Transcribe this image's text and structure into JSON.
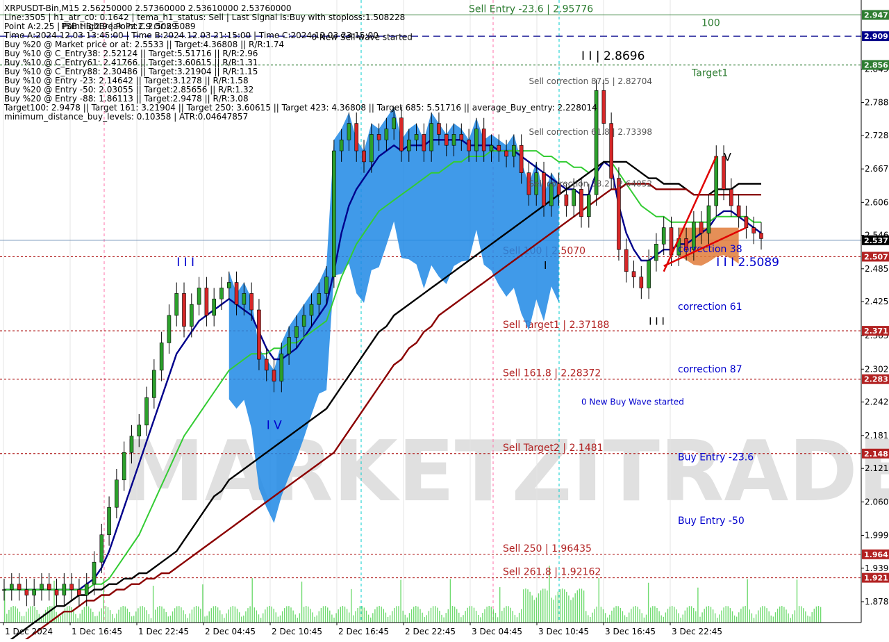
{
  "symbol_header": "XRPUSDT-Bin,M15  2.56250000 2.57360000 2.53610000 2.53760000",
  "info_lines": [
    "Line:3505 | h1_atr_c0: 0.1642 | tema_h1_status: Sell | Last Signal is:Buy with stoploss:1.508228",
    "Point A:2.25 | Point B:2.9 | Point C:2.5089",
    "Time A:2024.12.03 13:45:00 | Time B:2024.12.03 21:15:00 | Time C:2024.12.03 23:15:00",
    "Buy %20 @ Market price or at: 2.5533 || Target:4.36808 || R/R:1.74",
    "Buy %10 @ C_Entry38: 2.52124 || Target:5.51716 || R/R:2.96",
    "Buy %10 @ C_Entry61: 2.41766 || Target:3.60615 || R/R:1.31",
    "Buy %10 @ C_Entry88: 2.30486 || Target:3.21904 || R/R:1.15",
    "Buy %10 @ Entry -23: 2.14642 || Target:3.1278 || R/R:1.58",
    "Buy %20 @ Entry -50: 2.03055 || Target:2.85656 || R/R:1.32",
    "Buy %20 @ Entry -88: 1.86113 || Target:2.9478 || R/R:3.08",
    "Target100: 2.9478 || Target 161: 3.21904 || Target 250: 3.60615 || Target 423: 4.36808 || Target 685: 5.51716 || average_Buy_entry: 2.228014",
    "minimum_distance_buy_levels: 0.10358 | ATR:0.04647857"
  ],
  "overlay_header": "PSB HighBreak Pz:2.9 Or:2.5089",
  "watermark": "MARKETZITRADE",
  "colors": {
    "bull": "#2ca02c",
    "bear": "#d62728",
    "blue_cloud": "#1e88e5",
    "orange_cloud": "#e07b39",
    "green_line": "#33cc33",
    "navy_line": "#00008b",
    "black_line": "#000000",
    "maroon_line": "#8b0000",
    "volume": "#33cc33"
  },
  "chart_data": {
    "type": "line",
    "title": "XRPUSDT-Bin,M15",
    "ylim": [
      1.84,
      2.975
    ],
    "x_tick_labels": [
      "1 Dec 2024",
      "1 Dec 16:45",
      "1 Dec 22:45",
      "2 Dec 04:45",
      "2 Dec 10:45",
      "2 Dec 16:45",
      "2 Dec 22:45",
      "3 Dec 04:45",
      "3 Dec 10:45",
      "3 Dec 16:45",
      "3 Dec 22:45"
    ],
    "y_ticks": [
      1.878,
      1.939,
      1.999,
      2.06,
      2.121,
      2.181,
      2.242,
      2.302,
      2.363,
      2.425,
      2.485,
      2.546,
      2.606,
      2.667,
      2.728,
      2.788,
      2.849
    ],
    "current_price": 2.537,
    "price_levels": [
      {
        "price": 2.9478,
        "tag": "2.947",
        "color": "#2e7d32",
        "dash": "solid",
        "label": "Sell Entry -23.6 | 2.95776",
        "label_color": "#2e7d32",
        "right_label": "100"
      },
      {
        "price": 2.909,
        "tag": "2.909",
        "color": "#00008b",
        "dash": "dashed",
        "label": "",
        "label_color": "#00008b",
        "right_label": ""
      },
      {
        "price": 2.8566,
        "tag": "2.856",
        "color": "#2e7d32",
        "dash": "dashed",
        "label": "",
        "label_color": "#2e7d32",
        "right_label": "Target1"
      },
      {
        "price": 2.507,
        "tag": "2.507",
        "color": "#b22222",
        "dash": "dashed",
        "label": "Sell 100 | 2.5070",
        "label_color": "#b22222",
        "right_label": ""
      },
      {
        "price": 2.3719,
        "tag": "2.371",
        "color": "#b22222",
        "dash": "dashed",
        "label": "Sell Target1 | 2.37188",
        "label_color": "#b22222",
        "right_label": ""
      },
      {
        "price": 2.2837,
        "tag": "2.283",
        "color": "#b22222",
        "dash": "dashed",
        "label": "Sell 161.8 | 2.28372",
        "label_color": "#b22222",
        "right_label": ""
      },
      {
        "price": 2.1481,
        "tag": "2.148",
        "color": "#b22222",
        "dash": "dashed",
        "label": "Sell Target2 | 2.1481",
        "label_color": "#b22222",
        "right_label": ""
      },
      {
        "price": 1.9644,
        "tag": "1.964",
        "color": "#b22222",
        "dash": "dashed",
        "label": "Sell  250 | 1.96435",
        "label_color": "#b22222",
        "right_label": ""
      },
      {
        "price": 1.9216,
        "tag": "1.921",
        "color": "#b22222",
        "dash": "dashed",
        "label": "Sell  261.8 | 1.92162",
        "label_color": "#b22222",
        "right_label": ""
      }
    ],
    "right_annotations": [
      {
        "text": "correction 38",
        "price": 2.515,
        "color": "#0000cd"
      },
      {
        "text": "correction 61",
        "price": 2.41,
        "color": "#0000cd"
      },
      {
        "text": "correction 87",
        "price": 2.296,
        "color": "#0000cd"
      },
      {
        "text": "Buy Entry -23.6",
        "price": 2.136,
        "color": "#0000cd"
      },
      {
        "text": "Buy Entry -50",
        "price": 2.02,
        "color": "#0000cd"
      }
    ],
    "annotations": [
      {
        "text": "0 New Sell wave started",
        "t": 41,
        "price": 2.902,
        "color": "#000000",
        "size": 12
      },
      {
        "text": "I I | 2.8696",
        "t": 77,
        "price": 2.866,
        "color": "#000000",
        "size": 17
      },
      {
        "text": "Sell correction 87.5 | 2.82704",
        "t": 70,
        "price": 2.822,
        "color": "#555555",
        "size": 12
      },
      {
        "text": "Sell correction 61.8 | 2.73398",
        "t": 70,
        "price": 2.729,
        "color": "#555555",
        "size": 12
      },
      {
        "text": "Sell correction 38.2 | 2.64052",
        "t": 70,
        "price": 2.635,
        "color": "#555555",
        "size": 12
      },
      {
        "text": "0 New Buy Wave started",
        "t": 77,
        "price": 2.237,
        "color": "#0000cd",
        "size": 12
      },
      {
        "text": "I I I",
        "t": 23,
        "price": 2.49,
        "color": "#0000cd",
        "size": 17
      },
      {
        "text": "I V",
        "t": 35,
        "price": 2.193,
        "color": "#0000cd",
        "size": 17
      },
      {
        "text": "I I I 2.5089",
        "t": 95,
        "price": 2.49,
        "color": "#0000cd",
        "size": 17
      },
      {
        "text": "V",
        "t": 96,
        "price": 2.682,
        "color": "#000000",
        "size": 16
      },
      {
        "text": "I",
        "t": 72,
        "price": 2.485,
        "color": "#000000",
        "size": 15
      },
      {
        "text": "I I I",
        "t": 86,
        "price": 2.383,
        "color": "#000000",
        "size": 15
      }
    ],
    "series": [
      {
        "name": "price",
        "values": [
          1.9,
          1.91,
          1.9,
          1.89,
          1.9,
          1.91,
          1.9,
          1.89,
          1.91,
          1.9,
          1.89,
          1.91,
          1.95,
          2.0,
          2.05,
          2.1,
          2.15,
          2.18,
          2.2,
          2.25,
          2.3,
          2.35,
          2.4,
          2.44,
          2.38,
          2.42,
          2.45,
          2.4,
          2.43,
          2.45,
          2.46,
          2.42,
          2.44,
          2.41,
          2.32,
          2.3,
          2.28,
          2.33,
          2.36,
          2.38,
          2.4,
          2.42,
          2.44,
          2.47,
          2.7,
          2.72,
          2.75,
          2.7,
          2.68,
          2.73,
          2.72,
          2.74,
          2.76,
          2.7,
          2.72,
          2.73,
          2.7,
          2.75,
          2.73,
          2.71,
          2.73,
          2.72,
          2.7,
          2.74,
          2.7,
          2.71,
          2.7,
          2.69,
          2.71,
          2.66,
          2.62,
          2.66,
          2.6,
          2.64,
          2.62,
          2.6,
          2.63,
          2.58,
          2.62,
          2.81,
          2.75,
          2.65,
          2.52,
          2.48,
          2.47,
          2.45,
          2.5,
          2.53,
          2.56,
          2.51,
          2.54,
          2.52,
          2.57,
          2.55,
          2.6,
          2.69,
          2.63,
          2.6,
          2.58,
          2.56,
          2.55,
          2.54
        ]
      },
      {
        "name": "blue_ma",
        "values": [
          1.9,
          1.9,
          1.9,
          1.9,
          1.9,
          1.9,
          1.9,
          1.9,
          1.9,
          1.9,
          1.9,
          1.91,
          1.92,
          1.94,
          1.97,
          2.01,
          2.05,
          2.09,
          2.13,
          2.17,
          2.21,
          2.25,
          2.29,
          2.33,
          2.35,
          2.37,
          2.39,
          2.4,
          2.41,
          2.42,
          2.43,
          2.42,
          2.41,
          2.4,
          2.37,
          2.34,
          2.32,
          2.32,
          2.33,
          2.34,
          2.36,
          2.38,
          2.4,
          2.42,
          2.48,
          2.55,
          2.6,
          2.63,
          2.65,
          2.67,
          2.69,
          2.7,
          2.71,
          2.7,
          2.71,
          2.71,
          2.71,
          2.72,
          2.72,
          2.72,
          2.72,
          2.72,
          2.71,
          2.71,
          2.71,
          2.71,
          2.7,
          2.7,
          2.7,
          2.69,
          2.68,
          2.67,
          2.66,
          2.65,
          2.64,
          2.63,
          2.63,
          2.62,
          2.62,
          2.66,
          2.68,
          2.67,
          2.6,
          2.55,
          2.52,
          2.5,
          2.5,
          2.51,
          2.52,
          2.52,
          2.53,
          2.53,
          2.54,
          2.55,
          2.56,
          2.58,
          2.59,
          2.59,
          2.58,
          2.57,
          2.56,
          2.55
        ]
      },
      {
        "name": "green_ma",
        "values": [
          1.9,
          1.9,
          1.9,
          1.9,
          1.9,
          1.9,
          1.9,
          1.9,
          1.9,
          1.9,
          1.9,
          1.9,
          1.91,
          1.91,
          1.92,
          1.94,
          1.96,
          1.98,
          2.0,
          2.03,
          2.06,
          2.09,
          2.12,
          2.15,
          2.18,
          2.2,
          2.22,
          2.24,
          2.26,
          2.28,
          2.3,
          2.31,
          2.32,
          2.33,
          2.33,
          2.33,
          2.34,
          2.34,
          2.35,
          2.35,
          2.36,
          2.37,
          2.38,
          2.39,
          2.43,
          2.47,
          2.5,
          2.53,
          2.55,
          2.57,
          2.59,
          2.6,
          2.61,
          2.62,
          2.63,
          2.64,
          2.65,
          2.66,
          2.66,
          2.67,
          2.68,
          2.68,
          2.69,
          2.69,
          2.69,
          2.7,
          2.7,
          2.7,
          2.7,
          2.7,
          2.7,
          2.7,
          2.69,
          2.69,
          2.68,
          2.68,
          2.67,
          2.67,
          2.66,
          2.67,
          2.68,
          2.68,
          2.66,
          2.64,
          2.62,
          2.6,
          2.59,
          2.58,
          2.58,
          2.57,
          2.57,
          2.57,
          2.57,
          2.57,
          2.57,
          2.58,
          2.58,
          2.58,
          2.58,
          2.58,
          2.57,
          2.57
        ]
      },
      {
        "name": "black_ma",
        "values": [
          1.8,
          1.81,
          1.82,
          1.83,
          1.84,
          1.85,
          1.86,
          1.87,
          1.87,
          1.88,
          1.89,
          1.89,
          1.9,
          1.9,
          1.91,
          1.91,
          1.92,
          1.92,
          1.93,
          1.93,
          1.94,
          1.95,
          1.96,
          1.97,
          1.99,
          2.01,
          2.03,
          2.05,
          2.07,
          2.08,
          2.1,
          2.11,
          2.12,
          2.13,
          2.14,
          2.15,
          2.16,
          2.17,
          2.18,
          2.19,
          2.2,
          2.21,
          2.22,
          2.23,
          2.25,
          2.27,
          2.29,
          2.31,
          2.33,
          2.35,
          2.37,
          2.38,
          2.4,
          2.41,
          2.42,
          2.43,
          2.44,
          2.45,
          2.46,
          2.47,
          2.48,
          2.49,
          2.5,
          2.51,
          2.52,
          2.53,
          2.54,
          2.55,
          2.56,
          2.57,
          2.58,
          2.59,
          2.6,
          2.61,
          2.62,
          2.63,
          2.64,
          2.65,
          2.66,
          2.67,
          2.68,
          2.68,
          2.68,
          2.68,
          2.67,
          2.66,
          2.65,
          2.65,
          2.64,
          2.64,
          2.64,
          2.63,
          2.62,
          2.62,
          2.62,
          2.63,
          2.63,
          2.63,
          2.64,
          2.64,
          2.64,
          2.64
        ]
      },
      {
        "name": "maroon_ma",
        "values": [
          1.78,
          1.79,
          1.8,
          1.81,
          1.82,
          1.83,
          1.84,
          1.85,
          1.86,
          1.86,
          1.87,
          1.88,
          1.88,
          1.89,
          1.89,
          1.9,
          1.9,
          1.91,
          1.91,
          1.92,
          1.92,
          1.93,
          1.93,
          1.94,
          1.95,
          1.96,
          1.97,
          1.98,
          1.99,
          2.0,
          2.01,
          2.02,
          2.03,
          2.04,
          2.05,
          2.06,
          2.07,
          2.08,
          2.09,
          2.1,
          2.11,
          2.12,
          2.13,
          2.14,
          2.15,
          2.17,
          2.19,
          2.21,
          2.23,
          2.25,
          2.27,
          2.29,
          2.31,
          2.32,
          2.34,
          2.35,
          2.37,
          2.38,
          2.4,
          2.41,
          2.42,
          2.43,
          2.44,
          2.45,
          2.46,
          2.47,
          2.48,
          2.49,
          2.5,
          2.51,
          2.52,
          2.53,
          2.54,
          2.55,
          2.56,
          2.57,
          2.58,
          2.59,
          2.6,
          2.61,
          2.62,
          2.63,
          2.63,
          2.64,
          2.64,
          2.64,
          2.64,
          2.63,
          2.63,
          2.63,
          2.63,
          2.63,
          2.62,
          2.62,
          2.62,
          2.62,
          2.62,
          2.62,
          2.62,
          2.62,
          2.62,
          2.62
        ]
      }
    ]
  }
}
